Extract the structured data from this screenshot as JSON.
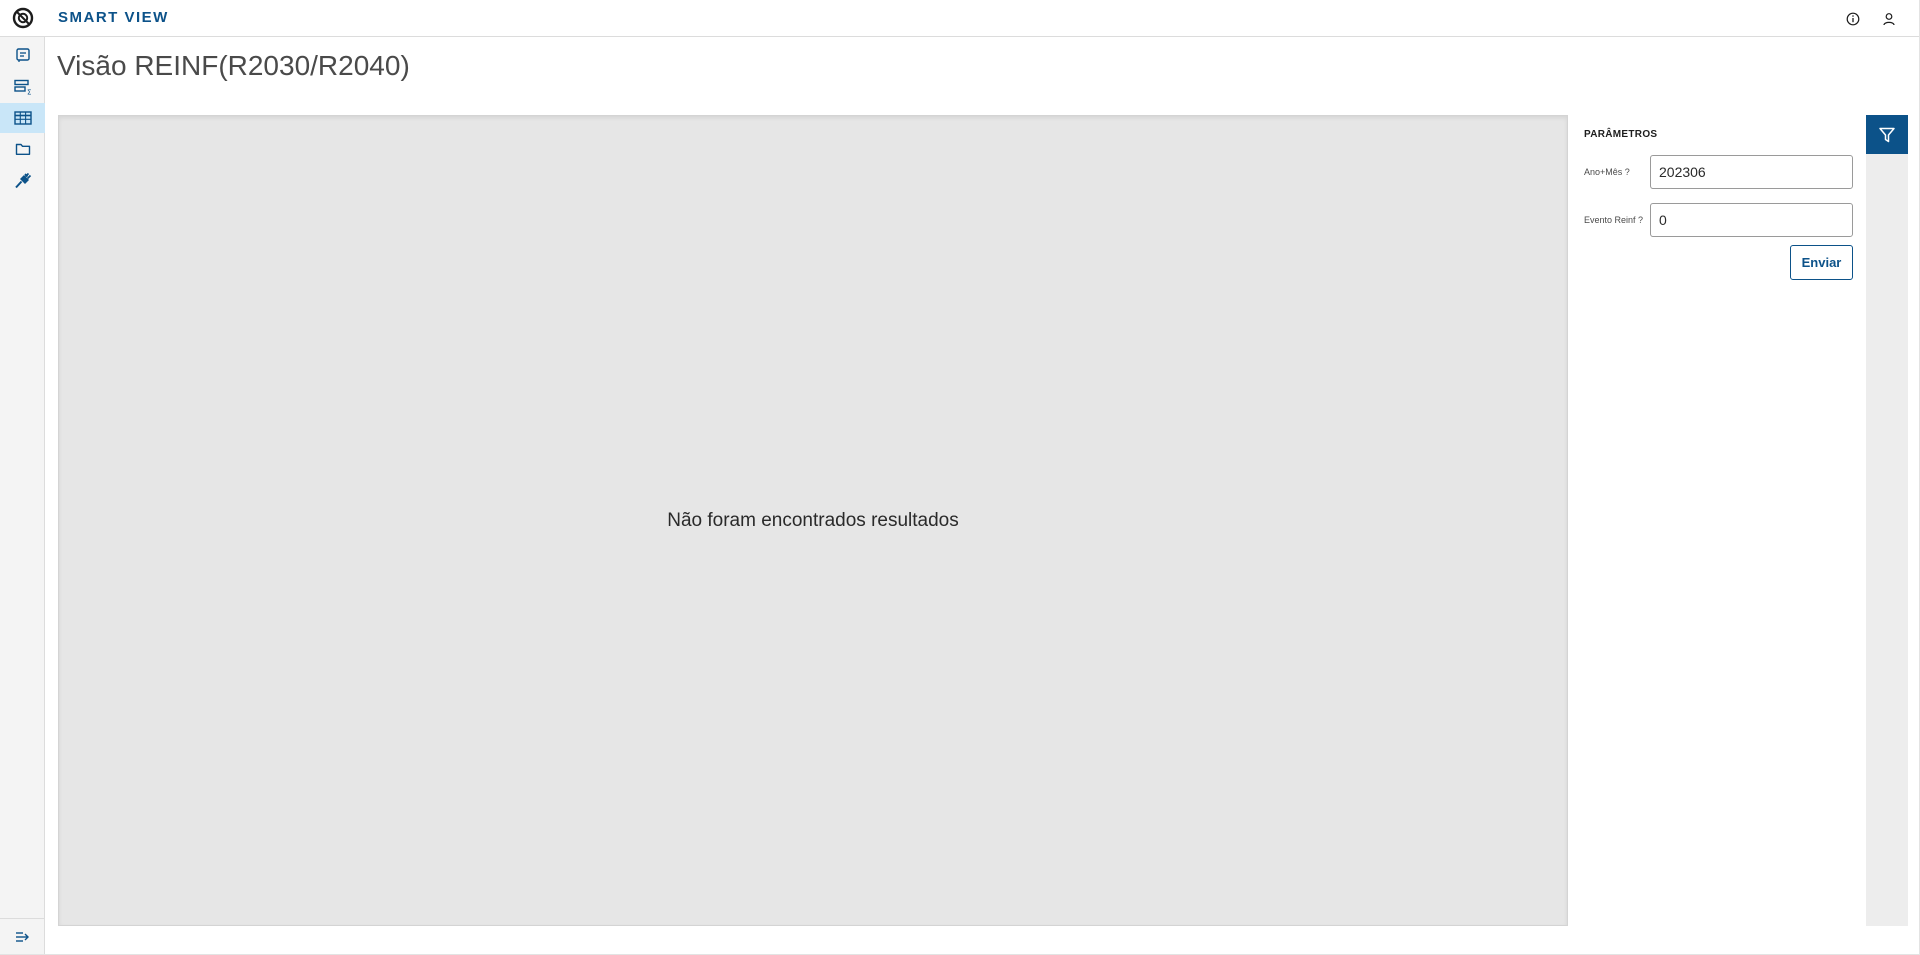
{
  "header": {
    "app_name": "SMART VIEW",
    "icons": [
      "info-icon",
      "user-icon"
    ]
  },
  "sidebar": {
    "items": [
      {
        "name": "reports-icon",
        "active": false
      },
      {
        "name": "data-summary-icon",
        "active": false
      },
      {
        "name": "table-icon",
        "active": true
      },
      {
        "name": "folder-icon",
        "active": false
      },
      {
        "name": "plug-icon",
        "active": false
      }
    ],
    "collapse_icon": "expand-menu-icon"
  },
  "page": {
    "title": "Visão REINF(R2030/R2040)"
  },
  "results": {
    "empty_message": "Não foram encontrados resultados"
  },
  "parameters": {
    "title": "PARÂMETROS",
    "fields": [
      {
        "label": "Ano+Mês ?",
        "value": "202306"
      },
      {
        "label": "Evento Reinf ?",
        "value": "0"
      }
    ],
    "submit_label": "Enviar"
  },
  "colors": {
    "brand": "#0c5289",
    "active_nav": "#c9e6f8",
    "results_bg": "#e6e6e6"
  }
}
